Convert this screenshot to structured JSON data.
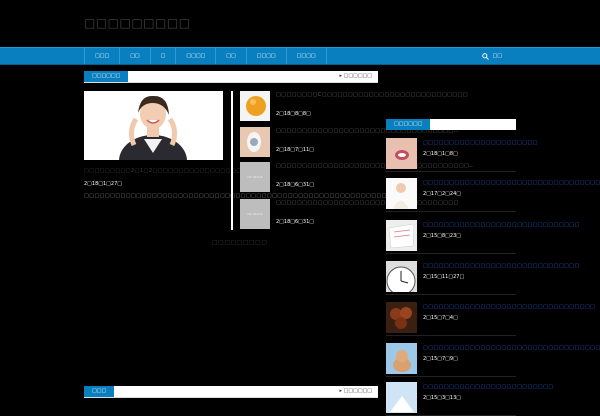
{
  "site": {
    "title": "□□□□□□□□□"
  },
  "nav": {
    "items": [
      "□□□",
      "□□",
      "□",
      "□□□□",
      "□□",
      "□□□□",
      "□□□□"
    ],
    "search_label": "□□"
  },
  "main": {
    "section_tag": "□□□□□□",
    "more_label": "▸ □□□□□□",
    "featured": {
      "title": "□□□□□□□□□2□1□2□□□□□□□□□□□□□□□□□!!",
      "date": "2□18□1□27□",
      "excerpt": "□□□□□□□□□□□□□□□□□□□□□□□□□□□□□□□□□□□□□□□□□□□□□□□□□□□□□□□□□□□□□…"
    },
    "posts": [
      {
        "title": "□□□□□□□□C□□□□□□□□□□□□□□□□□□□□□□□□□□□□",
        "date": "2□18□8□8□",
        "thumb": "orange"
      },
      {
        "title": "□□□□□□□□□□□□□□□□□□□□□□□□□□□□□□□□□□…",
        "date": "2□18□7□11□",
        "thumb": "ear"
      },
      {
        "title": "□□□□□□□□□□□□□□□□□□□□□□□□□□□□□□□□□□□□□…",
        "date": "2□18□6□31□",
        "thumb": "no-image",
        "noimg_label": "NO IMAGE"
      },
      {
        "title": "□□□□□□□□□□□□□□□□□□□□□□□□□□□□□□□□□□□",
        "date": "2□18□6□31□",
        "thumb": "no-image",
        "noimg_label": "NO IMAGE"
      }
    ],
    "more_center": "□□□□□□□□□",
    "bottom_section_tag": "□□□",
    "bottom_more_label": "▸ □□□□□□"
  },
  "sidebar": {
    "tag": "□□□□□□",
    "items": [
      {
        "title": "□□□□□□□□□□□□□□□□□□□□□□",
        "date": "2□18□1□8□",
        "thumb": "mouth"
      },
      {
        "title": "□□□□□□□□□□□□□□□□□□□□□□□□□□□□□□□□□□",
        "date": "2□17□2□24□",
        "thumb": "person"
      },
      {
        "title": "□□□□□□□□□□□□□□□□□□□□□□□□□□□□□□",
        "date": "2□15□8□23□",
        "thumb": "paper"
      },
      {
        "title": "□□□□□□□□□□□□□□□□□□□□□□□□□□□□□□",
        "date": "2□15□11□27□",
        "thumb": "clock"
      },
      {
        "title": "□□□□□□□□□□□□□□□□□□□□□□□□□□□□□□□□□",
        "date": "2□15□7□4□",
        "thumb": "chestnut"
      },
      {
        "title": "□□□□□□□□□□□□□□□□□□□□□□□□□□□□□□□□□□",
        "date": "2□15□7□9□",
        "thumb": "cat"
      },
      {
        "title": "□□□□□□□□□□□□□□□□□□□□□□□□□",
        "date": "2□15□3□13□",
        "thumb": "sky"
      }
    ]
  },
  "colors": {
    "accent": "#0a7fbf",
    "link": "#2b5dd6"
  },
  "icons": {
    "search": "search-icon"
  }
}
